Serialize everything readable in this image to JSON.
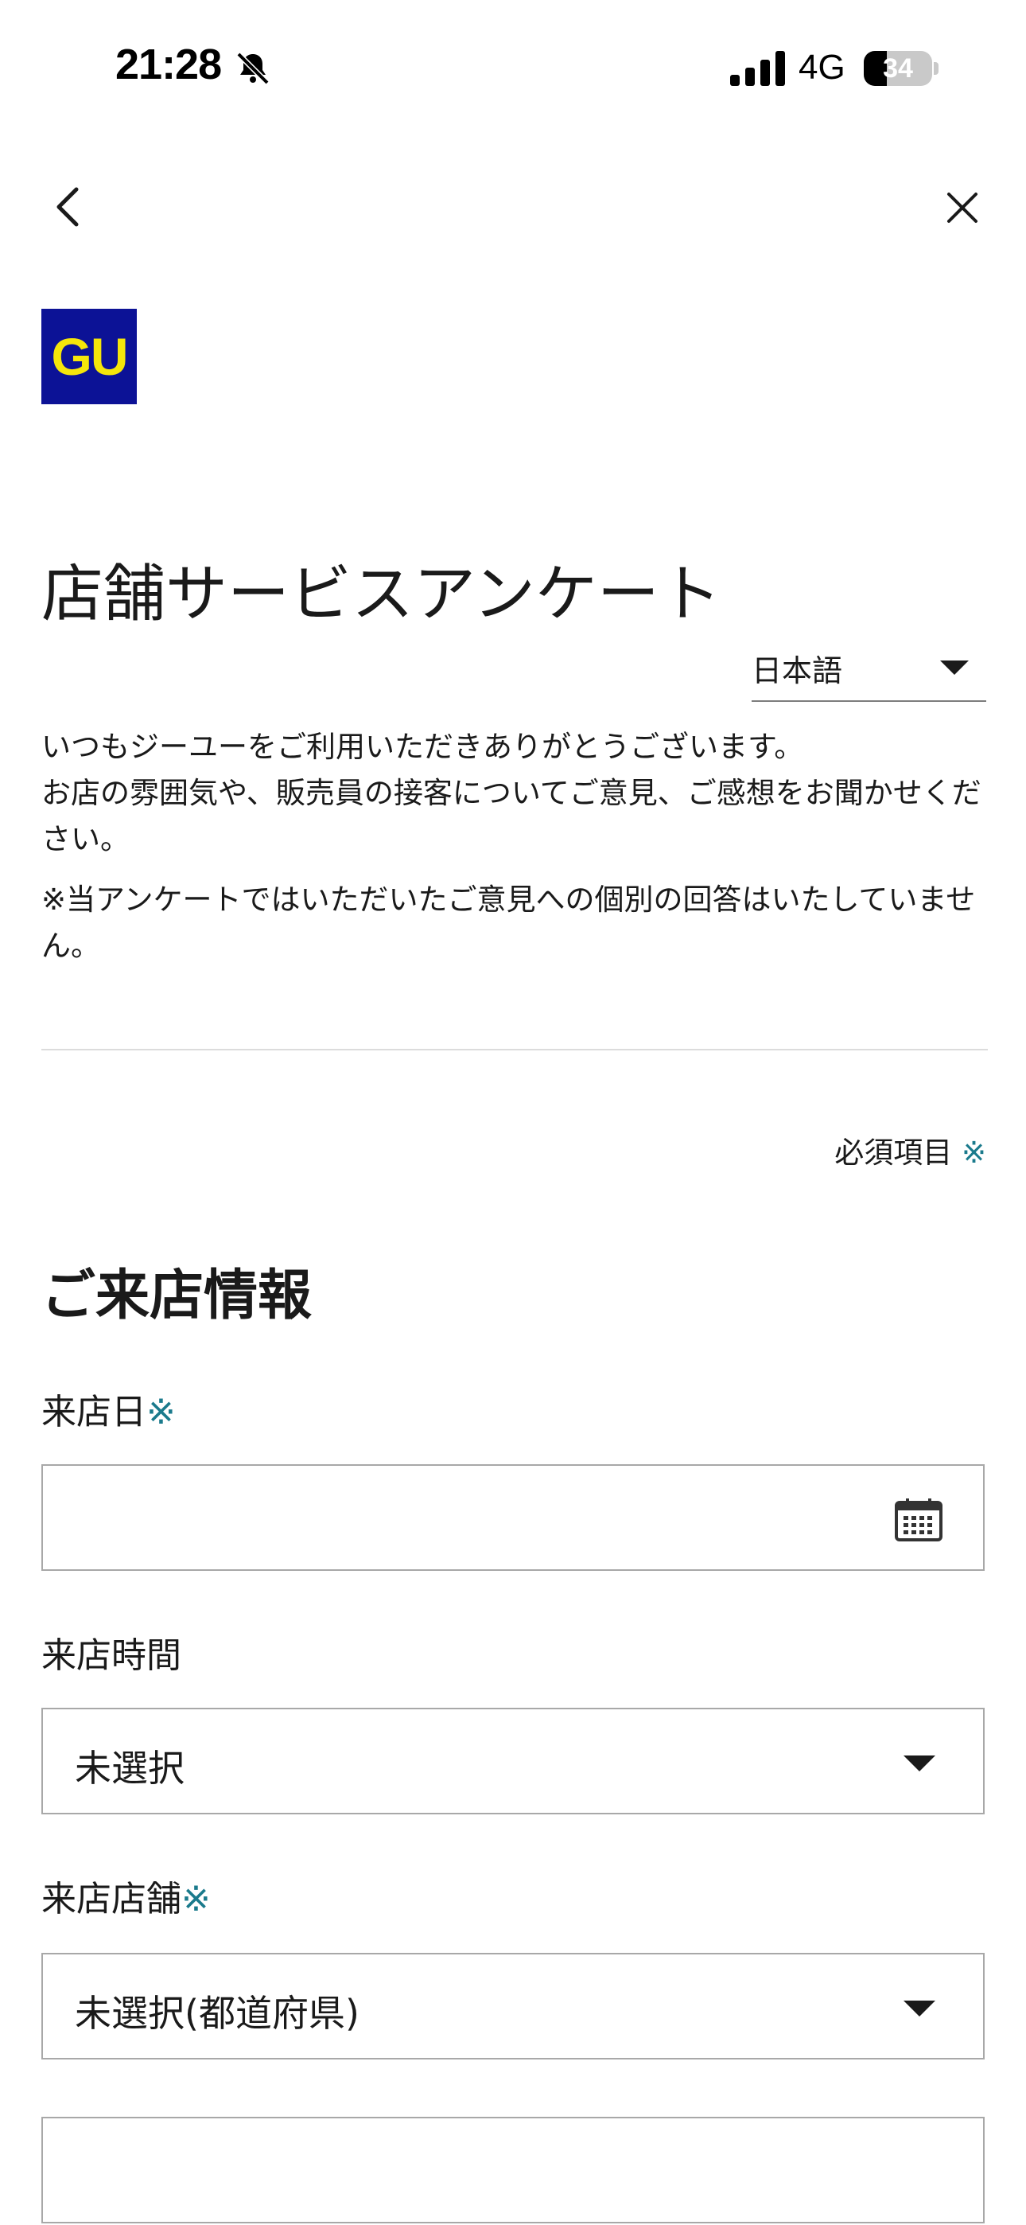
{
  "status_bar": {
    "time": "21:28",
    "network": "4G",
    "battery_level": "34",
    "battery_fraction": 0.34
  },
  "nav": {
    "back_icon": "chevron-left-icon",
    "close_icon": "close-icon"
  },
  "brand": {
    "logo_text": "GU",
    "logo_bg": "#0c1296",
    "logo_fg": "#f5e60a"
  },
  "page": {
    "title": "店舗サービスアンケート"
  },
  "language": {
    "selected": "日本語"
  },
  "intro": {
    "line1": "いつもジーユーをご利用いただきありがとうございます。",
    "line2": "お店の雰囲気や、販売員の接客についてご意見、ご感想をお聞かせください。",
    "notice": "※当アンケートではいただいたご意見への個別の回答はいたしていません。"
  },
  "required_legend": {
    "text": "必須項目",
    "mark": "※",
    "mark_color": "#1a7a8c"
  },
  "section": {
    "title": "ご来店情報"
  },
  "fields": {
    "visit_date": {
      "label": "来店日",
      "mark": "※",
      "value": ""
    },
    "visit_time": {
      "label": "来店時間",
      "value": "未選択"
    },
    "visit_store": {
      "label": "来店店舗",
      "mark": "※",
      "value": "未選択(都道府県)"
    }
  }
}
